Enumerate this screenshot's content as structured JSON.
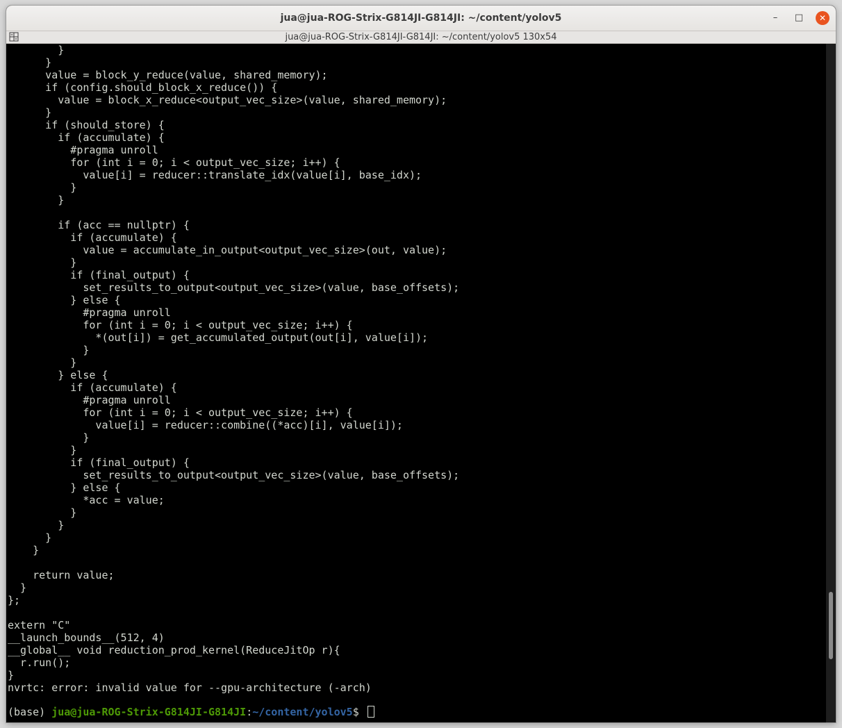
{
  "window": {
    "title": "jua@jua-ROG-Strix-G814JI-G814JI: ~/content/yolov5",
    "minimize_glyph": "–",
    "maximize_glyph": "□",
    "close_glyph": "✕"
  },
  "tab": {
    "title": "jua@jua-ROG-Strix-G814JI-G814JI: ~/content/yolov5 130x54",
    "icon": "terminal-split-icon"
  },
  "terminal": {
    "lines": [
      "        }",
      "      }",
      "      value = block_y_reduce(value, shared_memory);",
      "      if (config.should_block_x_reduce()) {",
      "        value = block_x_reduce<output_vec_size>(value, shared_memory);",
      "      }",
      "      if (should_store) {",
      "        if (accumulate) {",
      "          #pragma unroll",
      "          for (int i = 0; i < output_vec_size; i++) {",
      "            value[i] = reducer::translate_idx(value[i], base_idx);",
      "          }",
      "        }",
      "",
      "        if (acc == nullptr) {",
      "          if (accumulate) {",
      "            value = accumulate_in_output<output_vec_size>(out, value);",
      "          }",
      "          if (final_output) {",
      "            set_results_to_output<output_vec_size>(value, base_offsets);",
      "          } else {",
      "            #pragma unroll",
      "            for (int i = 0; i < output_vec_size; i++) {",
      "              *(out[i]) = get_accumulated_output(out[i], value[i]);",
      "            }",
      "          }",
      "        } else {",
      "          if (accumulate) {",
      "            #pragma unroll",
      "            for (int i = 0; i < output_vec_size; i++) {",
      "              value[i] = reducer::combine((*acc)[i], value[i]);",
      "            }",
      "          }",
      "          if (final_output) {",
      "            set_results_to_output<output_vec_size>(value, base_offsets);",
      "          } else {",
      "            *acc = value;",
      "          }",
      "        }",
      "      }",
      "    }",
      "",
      "    return value;",
      "  }",
      "};",
      "",
      "extern \"C\"",
      "__launch_bounds__(512, 4)",
      "__global__ void reduction_prod_kernel(ReduceJitOp r){",
      "  r.run();",
      "}",
      "nvrtc: error: invalid value for --gpu-architecture (-arch)",
      ""
    ],
    "prompt": {
      "env": "(base) ",
      "user_host": "jua@jua-ROG-Strix-G814JI-G814JI",
      "separator": ":",
      "path": "~/content/yolov5",
      "symbol": "$ "
    },
    "colors": {
      "background": "#000000",
      "foreground": "#d3d7cf",
      "prompt_user": "#4e9a06",
      "prompt_path": "#3465a4"
    }
  },
  "scrollbar": {
    "position_fraction": 0.9,
    "visible_fraction": 0.1
  }
}
